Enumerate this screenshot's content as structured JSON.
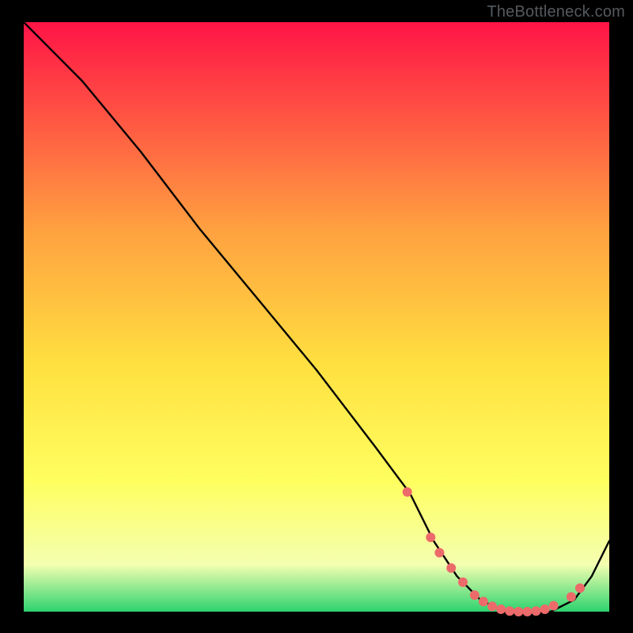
{
  "watermark": "TheBottleneck.com",
  "colors": {
    "black": "#000000",
    "curve": "#000000",
    "marker": "#ed6a6a",
    "grad_top": "#ff1446",
    "grad_mid1": "#ffa040",
    "grad_mid2": "#ffe040",
    "grad_low1": "#ffff60",
    "grad_low2": "#f4ffb0",
    "grad_bottom": "#2dd36f"
  },
  "chart_data": {
    "type": "line",
    "title": "",
    "xlabel": "",
    "ylabel": "",
    "xlim": [
      0,
      100
    ],
    "ylim": [
      0,
      100
    ],
    "series": [
      {
        "name": "bottleneck-curve",
        "x": [
          0,
          6,
          10,
          20,
          30,
          40,
          50,
          60,
          66,
          70,
          74,
          78,
          82,
          86,
          90,
          94,
          97,
          100
        ],
        "y": [
          100,
          94,
          90,
          78,
          65,
          53,
          41,
          28,
          20,
          12,
          6,
          2,
          0,
          0,
          0,
          2,
          6,
          12
        ]
      }
    ],
    "markers": {
      "name": "highlighted-points",
      "x": [
        65.5,
        69.5,
        71.0,
        73.0,
        75.0,
        77.0,
        78.5,
        80.0,
        81.5,
        83.0,
        84.5,
        86.0,
        87.5,
        89.0,
        90.5,
        93.5,
        95.0
      ],
      "y": [
        20.3,
        12.6,
        10.0,
        7.4,
        5.0,
        2.8,
        1.7,
        0.9,
        0.4,
        0.1,
        0.0,
        0.0,
        0.1,
        0.4,
        1.0,
        2.5,
        4.0
      ]
    }
  }
}
